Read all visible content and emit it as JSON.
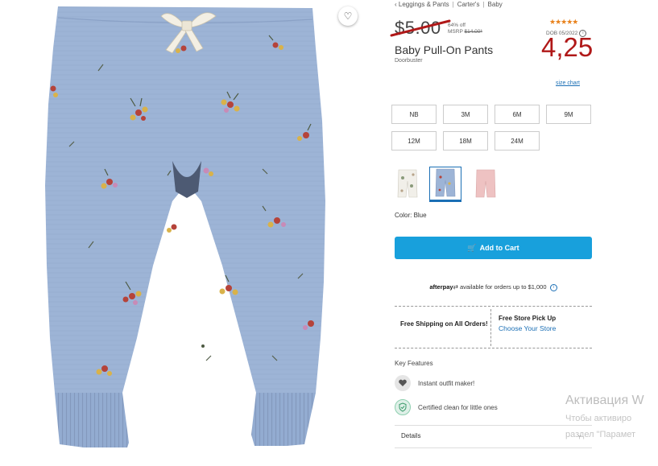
{
  "breadcrumb": {
    "items": [
      "‹ Leggings & Pants",
      "Carter's",
      "Baby"
    ]
  },
  "product": {
    "old_price": "$5.00",
    "discount_line1": "64% off",
    "msrp_label": "MSRP",
    "msrp_value": "$14.00*",
    "rating_stars": "★★★★★",
    "date_code": "DOB 05/2022",
    "new_price_annotation": "4,25",
    "title": "Baby Pull-On Pants",
    "subtitle": "Doorbuster",
    "size_chart_label": "size chart"
  },
  "sizes": [
    "NB",
    "3M",
    "6M",
    "9M",
    "12M",
    "18M",
    "24M"
  ],
  "colors": {
    "options": [
      "floral-white",
      "floral-blue",
      "pink"
    ],
    "selected_index": 1,
    "label": "Color: Blue"
  },
  "cart": {
    "label": "Add to Cart"
  },
  "afterpay": {
    "brand": "afterpay",
    "text": "available for orders up to $1,000"
  },
  "shipping": {
    "free_shipping": "Free Shipping on All Orders!",
    "pickup_title": "Free Store Pick Up",
    "pickup_link": "Choose Your Store"
  },
  "features": {
    "title": "Key Features",
    "items": [
      "Instant outfit maker!",
      "Certified clean for little ones"
    ]
  },
  "details": {
    "label": "Details"
  },
  "watermark": {
    "line1": "Активация W",
    "line2": "Чтобы активиро",
    "line3": "раздел \"Парамет"
  },
  "theme": {
    "accent": "#18a0dc",
    "link": "#1b6fb5",
    "annotation": "#b01818",
    "star": "#e8821c"
  }
}
